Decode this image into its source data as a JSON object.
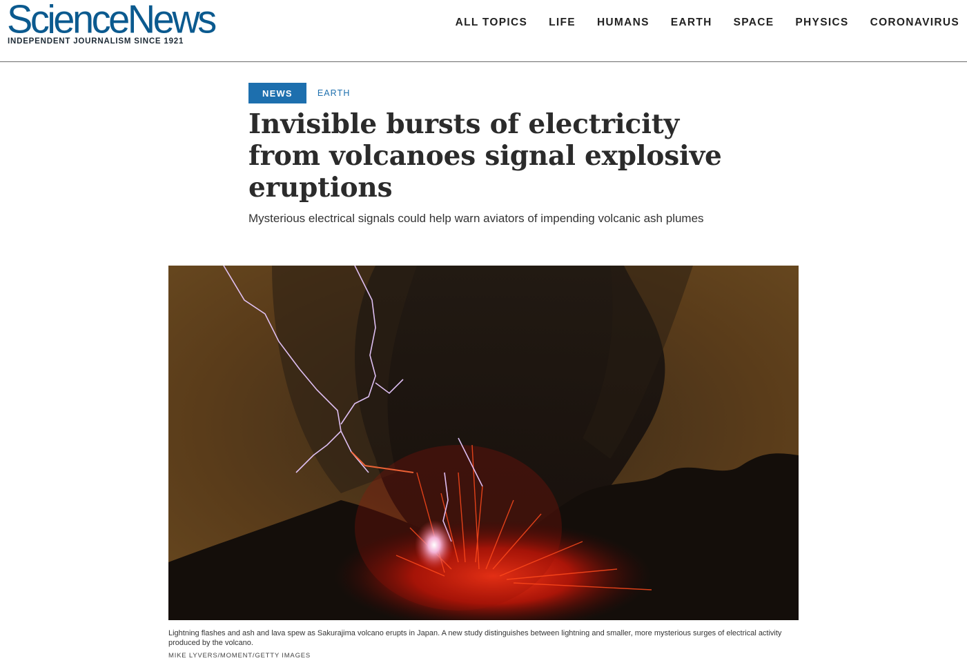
{
  "brand": {
    "name": "ScienceNews",
    "tagline": "INDEPENDENT JOURNALISM SINCE 1921",
    "color": "#0b5a8f"
  },
  "nav": {
    "items": [
      {
        "label": "ALL TOPICS"
      },
      {
        "label": "LIFE"
      },
      {
        "label": "HUMANS"
      },
      {
        "label": "EARTH"
      },
      {
        "label": "SPACE"
      },
      {
        "label": "PHYSICS"
      },
      {
        "label": "CORONAVIRUS"
      }
    ]
  },
  "article": {
    "type_tag": "NEWS",
    "topic_tag": "EARTH",
    "headline": "Invisible bursts of electricity from volcanoes signal explosive eruptions",
    "dek": "Mysterious electrical signals could help warn aviators of impending volcanic ash plumes",
    "accent": "#1d6fae"
  },
  "figure": {
    "caption": "Lightning flashes and ash and lava spew as Sakurajima volcano erupts in Japan. A new study distinguishes between lightning and smaller, more mysterious surges of electrical activity produced by the volcano.",
    "credit": "MIKE LYVERS/MOMENT/GETTY IMAGES"
  }
}
